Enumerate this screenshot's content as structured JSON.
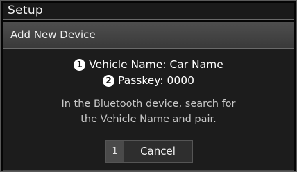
{
  "window": {
    "title": "Setup"
  },
  "dialog": {
    "title": "Add New Device",
    "items": [
      {
        "number": "1",
        "text": "Vehicle Name: Car Name"
      },
      {
        "number": "2",
        "text": "Passkey: 0000"
      }
    ],
    "instructions": [
      "In the Bluetooth device, search for",
      "the Vehicle Name and pair."
    ],
    "cancel_button": {
      "index": "1",
      "label": "Cancel"
    }
  }
}
